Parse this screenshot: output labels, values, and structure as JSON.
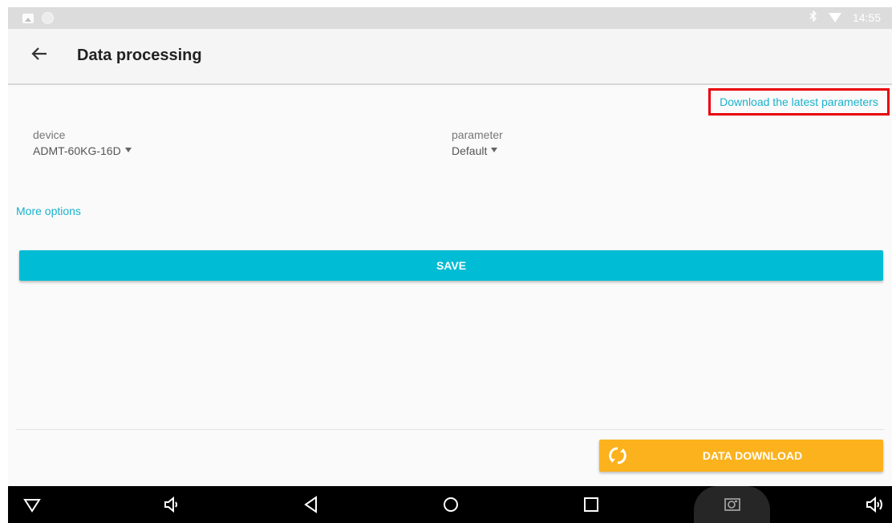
{
  "status_bar": {
    "time": "14:55",
    "icons": [
      "image-icon",
      "circle-icon",
      "bluetooth-icon",
      "wifi-icon"
    ]
  },
  "toolbar": {
    "back_icon": "arrow-left-icon",
    "title": "Data processing"
  },
  "content": {
    "download_params_link": "Download the latest parameters",
    "device": {
      "label": "device",
      "value": "ADMT-60KG-16D"
    },
    "parameter": {
      "label": "parameter",
      "value": "Default"
    },
    "more_options_link": "More options",
    "save_button": "SAVE"
  },
  "footer": {
    "data_download_button": "DATA DOWNLOAD",
    "data_download_icon": "sync-icon"
  },
  "nav_bar": {
    "icons": [
      "collapse-icon",
      "volume-down-icon",
      "back-icon",
      "home-icon",
      "recents-icon",
      "screenshot-icon",
      "volume-up-icon"
    ]
  },
  "colors": {
    "accent": "#00bcd4",
    "link": "#19b2cc",
    "highlight_border": "#e8000a",
    "download_button": "#fbb21d",
    "nav_bar": "#000000"
  }
}
